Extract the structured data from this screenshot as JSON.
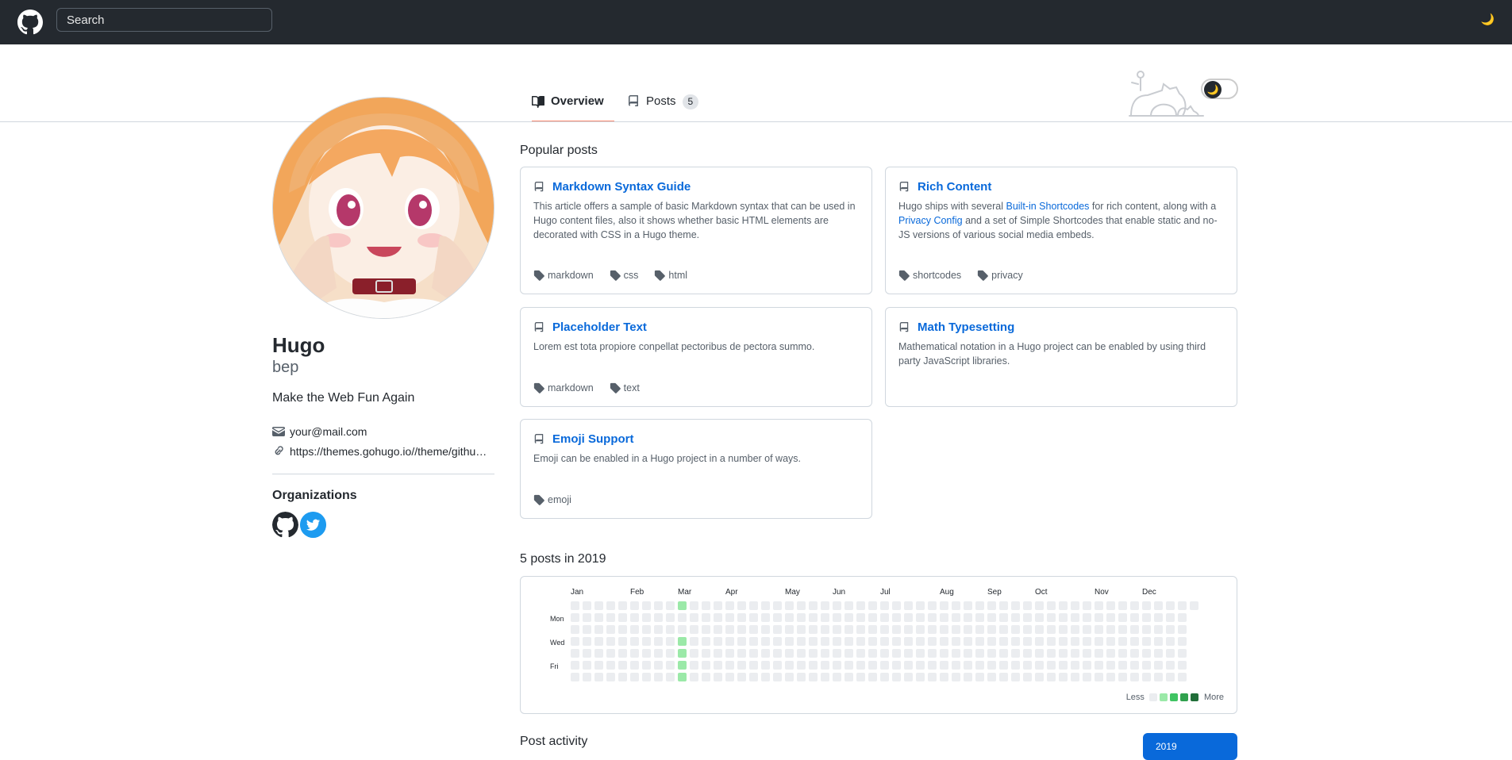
{
  "topbar": {
    "search_placeholder": "Search",
    "theme_icon": "moon-icon"
  },
  "tabs": [
    {
      "label": "Overview",
      "icon": "book-icon",
      "selected": true
    },
    {
      "label": "Posts",
      "icon": "repo-icon",
      "count": "5"
    }
  ],
  "profile": {
    "name": "Hugo",
    "login": "bep",
    "bio": "Make the Web Fun Again",
    "email": "your@mail.com",
    "url": "https://themes.gohugo.io//theme/github-style/",
    "organizations_title": "Organizations",
    "organizations": [
      {
        "icon": "github-icon"
      },
      {
        "icon": "twitter-icon",
        "color": "#1d9bf0"
      }
    ]
  },
  "popular": {
    "title": "Popular posts",
    "posts": [
      {
        "title": "Markdown Syntax Guide",
        "desc": "This article offers a sample of basic Markdown syntax that can be used in Hugo content files, also it shows whether basic HTML elements are decorated with CSS in a Hugo theme.",
        "tags": [
          "markdown",
          "css",
          "html"
        ]
      },
      {
        "title": "Rich Content",
        "desc_1": "Hugo ships with several ",
        "link_1": "Built-in Shortcodes",
        "desc_2": " for rich content, along with a ",
        "link_2": "Privacy Config",
        "desc_3": " and a set of Simple Shortcodes that enable static and no-JS versions of various social media embeds.",
        "tags": [
          "shortcodes",
          "privacy"
        ]
      },
      {
        "title": "Placeholder Text",
        "desc": "Lorem est tota propiore conpellat pectoribus de pectora summo.",
        "tags": [
          "markdown",
          "text"
        ]
      },
      {
        "title": "Math Typesetting",
        "desc": "Mathematical notation in a Hugo project can be enabled by using third party JavaScript libraries.",
        "tags": []
      },
      {
        "title": "Emoji Support",
        "desc": "Emoji can be enabled in a Hugo project in a number of ways.",
        "tags": [
          "emoji"
        ]
      }
    ]
  },
  "calendar": {
    "title": "5 posts in 2019",
    "months": [
      "Jan",
      "Feb",
      "Mar",
      "Apr",
      "May",
      "Jun",
      "Jul",
      "Aug",
      "Sep",
      "Oct",
      "Nov",
      "Dec"
    ],
    "weekdays": [
      "Mon",
      "Wed",
      "Fri"
    ],
    "active_week": 9,
    "active_days": [
      0,
      3,
      4,
      5,
      6
    ],
    "legend_less": "Less",
    "legend_more": "More",
    "colors": {
      "empty": "#ebedf0",
      "level1": "#9be9a8",
      "level2": "#40c463",
      "level3": "#30a14e",
      "level4": "#216e39"
    }
  },
  "activity": {
    "title": "Post activity",
    "year": "2019"
  }
}
